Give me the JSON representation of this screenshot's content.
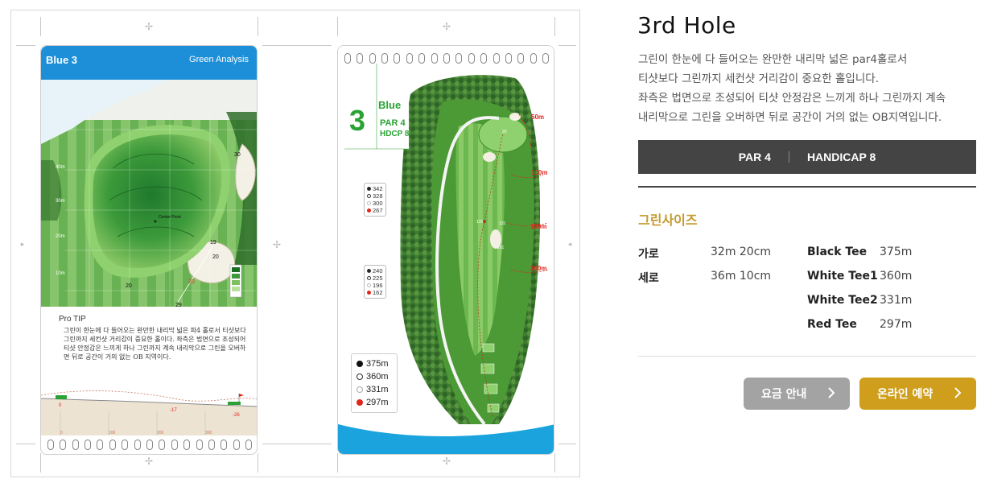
{
  "hole": {
    "title": "3rd Hole",
    "description": "그린이 한눈에 다 들어오는 완만한 내리막 넓은 par4홀로서\n티샷보다 그린까지 세컨샷 거리감이 중요한 홀입니다.\n좌측은 법면으로 조성되어 티샷 안정감은 느끼게 하나 그린까지 계속\n내리막으로 그린을 오버하면 뒤로 공간이 거의 없는 OB지역입니다.",
    "par_label": "PAR 4",
    "handicap_label": "HANDICAP 8"
  },
  "green_size": {
    "title": "그린사이즈",
    "width_label": "가로",
    "width_value": "32m 20cm",
    "length_label": "세로",
    "length_value": "36m 10cm"
  },
  "tees": [
    {
      "name": "Black Tee",
      "distance": "375m"
    },
    {
      "name": "White Tee1",
      "distance": "360m"
    },
    {
      "name": "White Tee2",
      "distance": "331m"
    },
    {
      "name": "Red Tee",
      "distance": "297m"
    }
  ],
  "buttons": {
    "price": "요금 안내",
    "reserve": "온라인 예약"
  },
  "green_card": {
    "course_tag": "Blue 3",
    "header_title": "Green Analysis",
    "tip_title": "Pro TIP",
    "tip_text": "그린이 한눈에 다 들어오는 완만한 내리막 넓은 파4 홀로서 티샷보다 그린까지 세컨샷 거리감이 중요한 홀이다. 좌측은 법면으로 조성되어 티샷 안정감은 느끼게 하나 그린까지 계속 내리막으로 그린을 오버하면 뒤로 공간이 거의 없는 OB 지역이다.",
    "y_ticks": [
      "40m",
      "30m",
      "20m",
      "10m",
      "0m"
    ],
    "green_marks": [
      "30",
      "20",
      "20",
      "29",
      "19",
      "20"
    ],
    "center_label": "Center Point",
    "elev": [
      "0",
      "-17",
      "-26"
    ],
    "profile_ticks": [
      "0",
      "100",
      "200",
      "300"
    ]
  },
  "hole_card": {
    "course": "Blue",
    "number": "3",
    "par": "PAR 4",
    "hdcp": "HDCP 8",
    "dist_markers": [
      "50m",
      "100m",
      "150m",
      "200m"
    ],
    "tee_legend": [
      "375m",
      "360m",
      "331m",
      "297m"
    ],
    "legend_upper": [
      "342",
      "328",
      "300",
      "267"
    ],
    "legend_lower": [
      "240",
      "225",
      "196",
      "162"
    ],
    "map_marks": [
      "20",
      "15",
      "125",
      "131",
      "161"
    ]
  },
  "colors": {
    "accent_gold": "#cf9e1c",
    "bar_dark": "#444444",
    "card_blue": "#1c8fd8",
    "fairway_green": "#3f9a2e",
    "distance_red": "#e0251b"
  }
}
